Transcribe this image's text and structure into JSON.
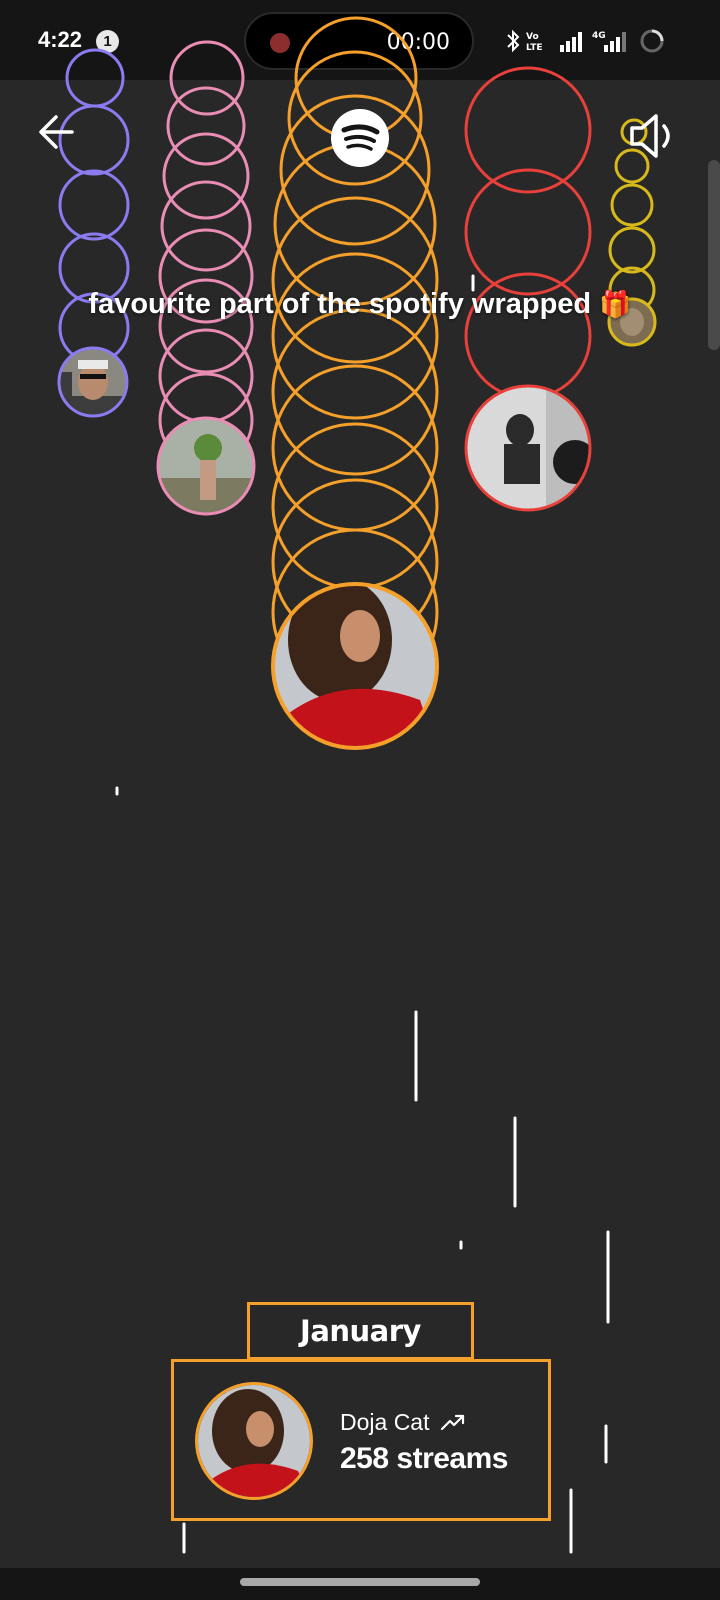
{
  "status_bar": {
    "time": "4:22",
    "notification_count": "1",
    "recording_time": "00:00",
    "network_label": "4G",
    "volte_label": "Vo LTE"
  },
  "header": {
    "back_icon": "arrow-left-icon",
    "logo_icon": "spotify-logo-icon",
    "sound_icon": "speaker-icon"
  },
  "caption": {
    "text": "favourite part of the spotify wrapped",
    "emoji": "🎁"
  },
  "artist_columns": [
    {
      "color": "#8a7cf0"
    },
    {
      "color": "#e98db5"
    },
    {
      "color": "#f5a02a"
    },
    {
      "color": "#e8413c"
    },
    {
      "color": "#d7b91c"
    }
  ],
  "highlight": {
    "month": "January",
    "artist": "Doja Cat",
    "streams": "258 streams",
    "accent_color": "#f5a02a"
  }
}
